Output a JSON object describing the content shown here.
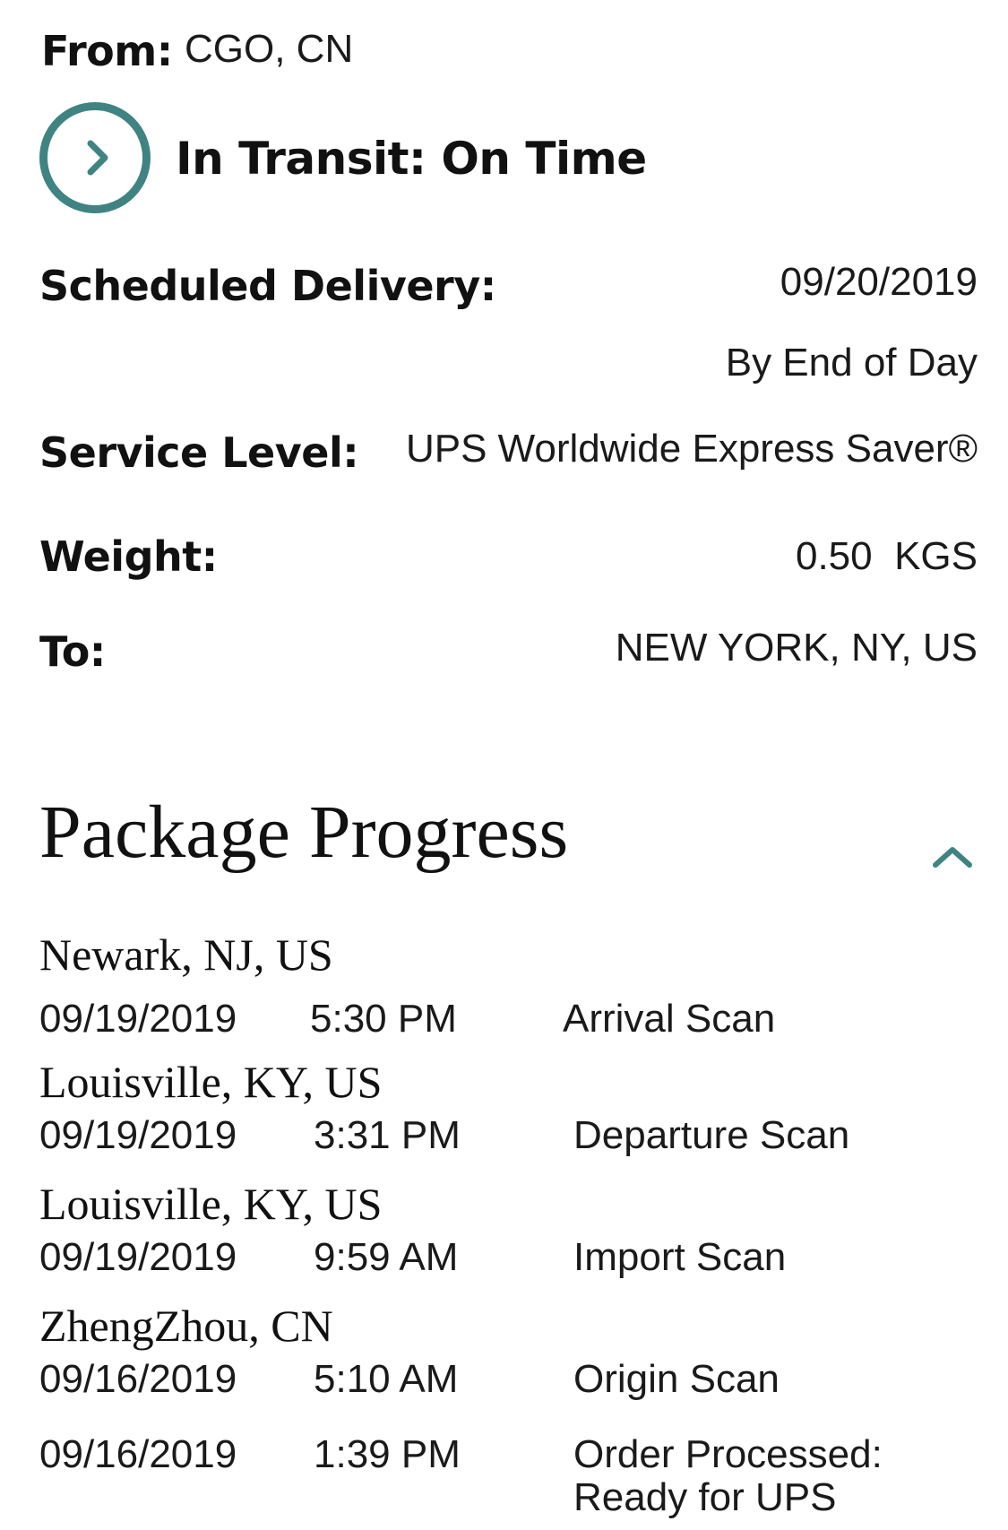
{
  "shipment": {
    "from_label": "From:",
    "from_value": "CGO, CN",
    "status_icon": "chevron-right-icon",
    "status_text": "In Transit: On Time",
    "scheduled_label": "Scheduled Delivery:",
    "scheduled_date": "09/20/2019",
    "scheduled_time": "By End of Day",
    "service_label": "Service Level:",
    "service_value": "UPS Worldwide Express Saver®",
    "weight_label": "Weight:",
    "weight_value": "0.50  KGS",
    "to_label": "To:",
    "to_value": "NEW YORK, NY, US"
  },
  "progress": {
    "title": "Package Progress",
    "collapse_icon": "chevron-up-icon",
    "events": [
      {
        "location": "Newark, NJ, US",
        "date": "09/19/2019",
        "time": "5:30 PM",
        "activity": "Arrival Scan"
      },
      {
        "location": "Louisville, KY, US",
        "date": "09/19/2019",
        "time": "3:31 PM",
        "activity": "Departure Scan"
      },
      {
        "location": "Louisville, KY, US",
        "date": "09/19/2019",
        "time": "9:59 AM",
        "activity": "Import Scan"
      },
      {
        "location": "ZhengZhou, CN",
        "date": "09/16/2019",
        "time": "5:10 AM",
        "activity": "Origin Scan"
      },
      {
        "location": "",
        "date": "09/16/2019",
        "time": "1:39 PM",
        "activity": "Order Processed:",
        "activity_line2": "Ready for UPS"
      }
    ]
  },
  "colors": {
    "accent": "#3f8482",
    "text": "#1a1a1a"
  }
}
